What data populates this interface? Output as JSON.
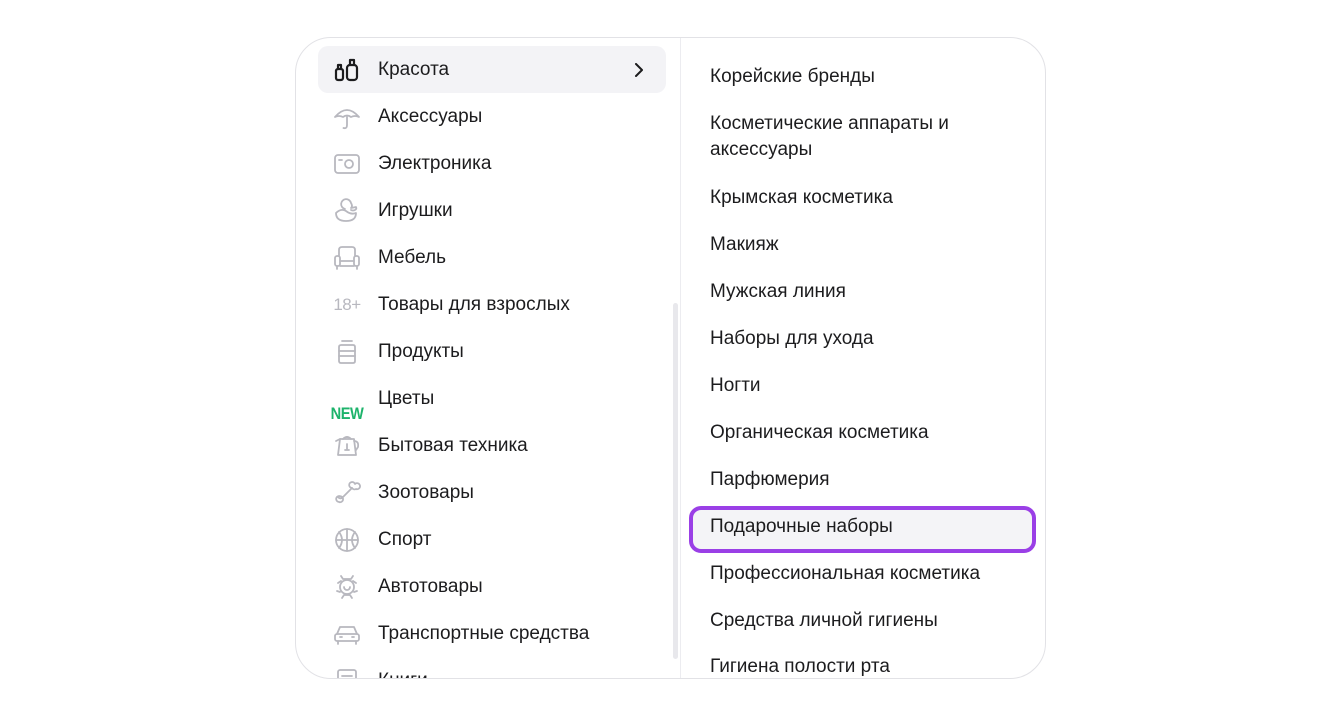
{
  "categories": [
    {
      "label": "Красота",
      "icon": "beauty-cosmetics-icon",
      "active": true
    },
    {
      "label": "Аксессуары",
      "icon": "umbrella-icon"
    },
    {
      "label": "Электроника",
      "icon": "camera-icon"
    },
    {
      "label": "Игрушки",
      "icon": "duck-toy-icon"
    },
    {
      "label": "Мебель",
      "icon": "armchair-icon"
    },
    {
      "label": "Товары для взрослых",
      "icon": "adults-18-plus-icon",
      "icon_text": "18+"
    },
    {
      "label": "Продукты",
      "icon": "jar-icon"
    },
    {
      "label": "Цветы",
      "icon": "new-badge-icon",
      "icon_text": "NEW"
    },
    {
      "label": "Бытовая техника",
      "icon": "kettle-icon"
    },
    {
      "label": "Зоотовары",
      "icon": "bone-icon"
    },
    {
      "label": "Спорт",
      "icon": "ball-icon"
    },
    {
      "label": "Автотовары",
      "icon": "car-part-icon"
    },
    {
      "label": "Транспортные средства",
      "icon": "car-icon"
    },
    {
      "label": "Книги",
      "icon": "book-icon"
    }
  ],
  "subcategories": [
    "Корейские бренды",
    "Косметические аппараты и аксессуары",
    "Крымская косметика",
    "Макияж",
    "Мужская линия",
    "Наборы для ухода",
    "Ногти",
    "Органическая косметика",
    "Парфюмерия",
    "Подарочные наборы",
    "Профессиональная косметика",
    "Средства личной гигиены",
    "Гигиена полости рта"
  ],
  "highlighted_subcategory": "Подарочные наборы",
  "colors": {
    "highlight_border": "#9a3fe6",
    "new_badge": "#1db36b",
    "active_bg": "#f3f3f6",
    "icon_gray": "#b8b8bf"
  }
}
